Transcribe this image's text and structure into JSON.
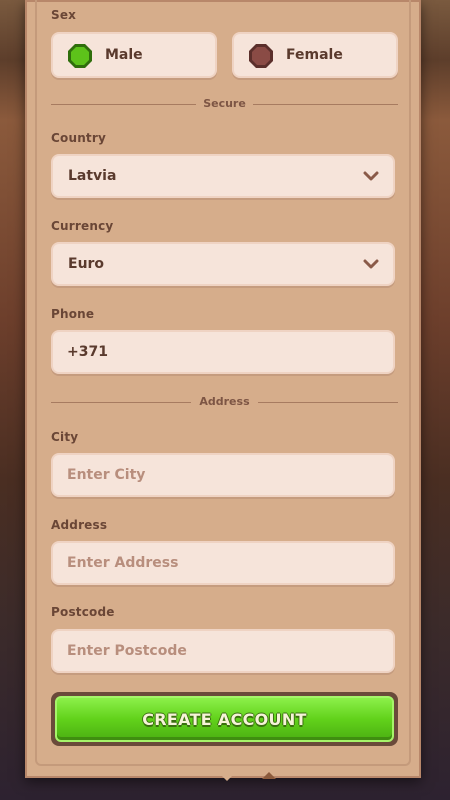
{
  "form": {
    "sex": {
      "label": "Sex",
      "options": [
        {
          "label": "Male",
          "selected": true,
          "color": "#5dc21a"
        },
        {
          "label": "Female",
          "selected": false,
          "color": "#8a4b45"
        }
      ]
    },
    "secure_divider": "Secure",
    "country": {
      "label": "Country",
      "value": "Latvia"
    },
    "currency": {
      "label": "Currency",
      "value": "Euro"
    },
    "phone": {
      "label": "Phone",
      "value": "+371"
    },
    "address_divider": "Address",
    "city": {
      "label": "City",
      "placeholder": "Enter City"
    },
    "address": {
      "label": "Address",
      "placeholder": "Enter Address"
    },
    "postcode": {
      "label": "Postcode",
      "placeholder": "Enter Postcode"
    },
    "submit_label": "CREATE ACCOUNT"
  },
  "colors": {
    "panel": "#d6ad8b",
    "field": "#f6e4da",
    "text": "#5a3a2d",
    "button": "#62d21b"
  }
}
